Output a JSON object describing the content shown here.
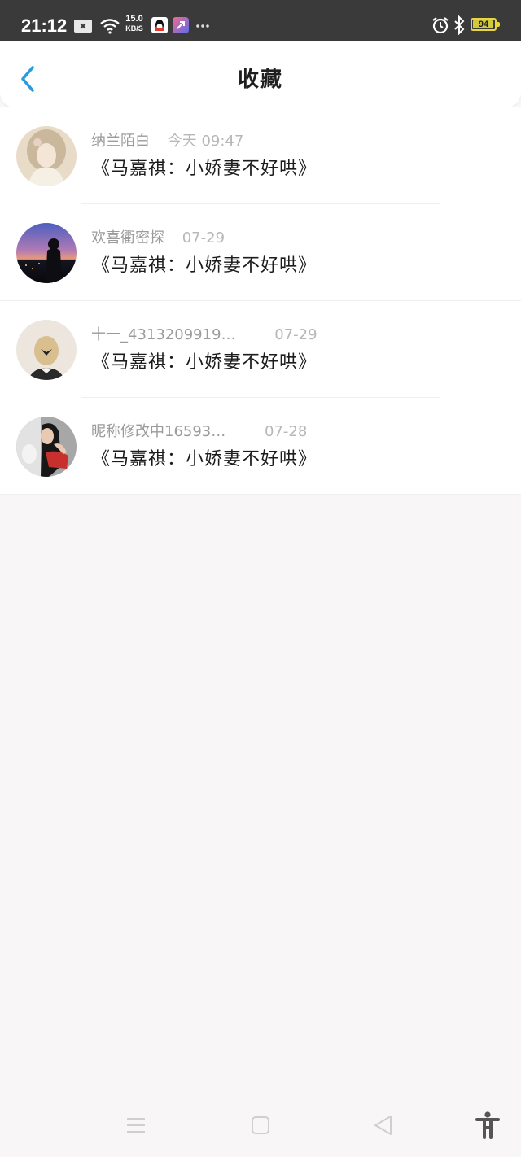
{
  "status_bar": {
    "time": "21:12",
    "net_speed_value": "15.0",
    "net_speed_unit": "KB/S",
    "battery_level": "94",
    "battery_fraction": 0.94,
    "icons": [
      "notification-x-icon",
      "wifi-icon",
      "qq-app-icon",
      "app-icon",
      "more-dots-icon",
      "alarm-icon",
      "bluetooth-icon",
      "battery-icon"
    ]
  },
  "header": {
    "title": "收藏",
    "back_icon": "chevron-left-icon",
    "accent_color": "#2a9be0"
  },
  "favorites": [
    {
      "username": "纳兰陌白",
      "date": "今天 09:47",
      "title": "《马嘉祺：小娇妻不好哄》"
    },
    {
      "username": "欢喜衢密探",
      "date": "07-29",
      "title": "《马嘉祺：小娇妻不好哄》"
    },
    {
      "username": "十一_4313209919…",
      "date": "07-29",
      "title": "《马嘉祺：小娇妻不好哄》"
    },
    {
      "username": "昵称修改中16593…",
      "date": "07-28",
      "title": "《马嘉祺：小娇妻不好哄》"
    }
  ],
  "nav_bar": {
    "icons": [
      "menu-icon",
      "home-square-icon",
      "back-triangle-icon",
      "accessibility-icon"
    ]
  }
}
